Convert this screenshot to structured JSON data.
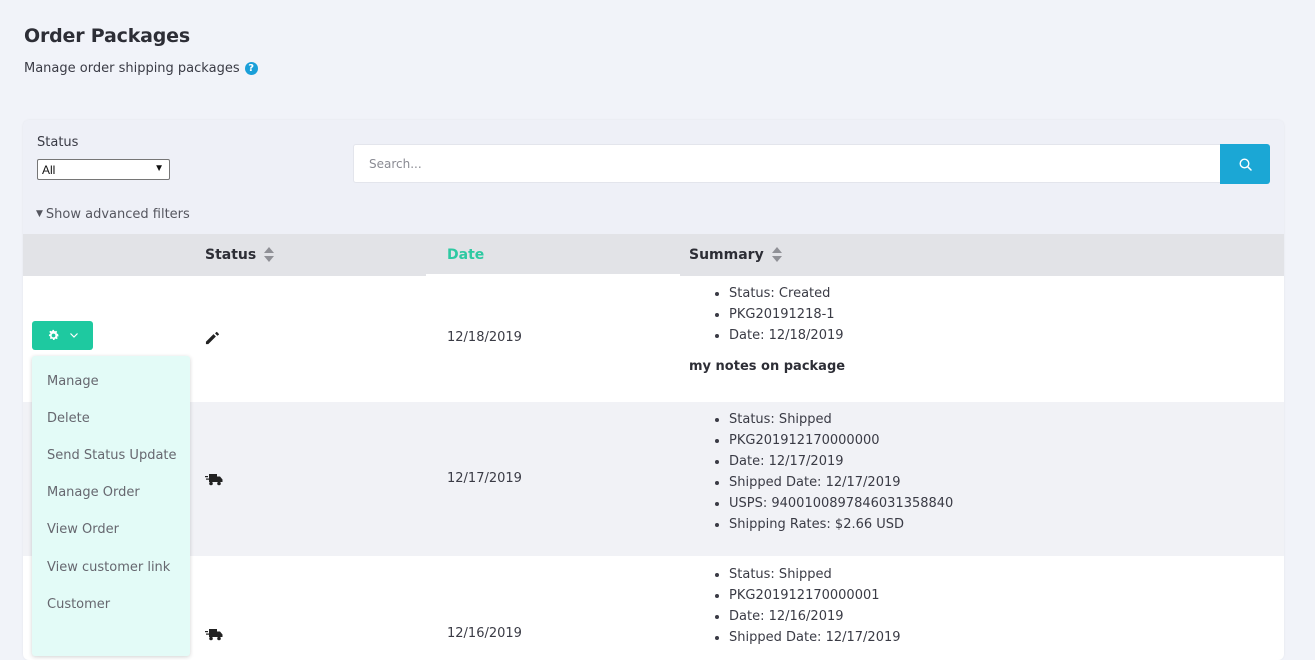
{
  "header": {
    "title": "Order Packages",
    "subtitle": "Manage order shipping packages",
    "help_icon": "question-circle-icon"
  },
  "filters": {
    "status_label": "Status",
    "status_value": "All",
    "search_placeholder": "Search...",
    "advanced_filters": "Show advanced filters"
  },
  "table": {
    "columns": [
      {
        "label": "Status",
        "sortable": true
      },
      {
        "label": "Date",
        "active": true
      },
      {
        "label": "Summary",
        "sortable": true
      }
    ],
    "rows": [
      {
        "status_icon": "pencil-icon",
        "date": "12/18/2019",
        "summary": [
          "Status: Created",
          "PKG20191218-1",
          "Date: 12/18/2019"
        ],
        "notes": "my notes on package"
      },
      {
        "status_icon": "truck-icon",
        "date": "12/17/2019",
        "summary": [
          "Status: Shipped",
          "PKG201912170000000",
          "Date: 12/17/2019",
          "Shipped Date: 12/17/2019",
          "USPS: 9400100897846031358840",
          "Shipping Rates: $2.66 USD"
        ]
      },
      {
        "status_icon": "truck-icon",
        "date": "12/16/2019",
        "summary": [
          "Status: Shipped",
          "PKG201912170000001",
          "Date: 12/16/2019",
          "Shipped Date: 12/17/2019"
        ]
      }
    ]
  },
  "actions_menu": {
    "items": [
      "Manage",
      "Delete",
      "Send Status Update",
      "Manage Order",
      "View Order",
      "View customer link",
      "Customer"
    ]
  },
  "colors": {
    "accent_green": "#1ec9a0",
    "search_blue": "#1ba7d5",
    "date_header": "#2ec9a2",
    "menu_bg": "#e3fbf7"
  }
}
